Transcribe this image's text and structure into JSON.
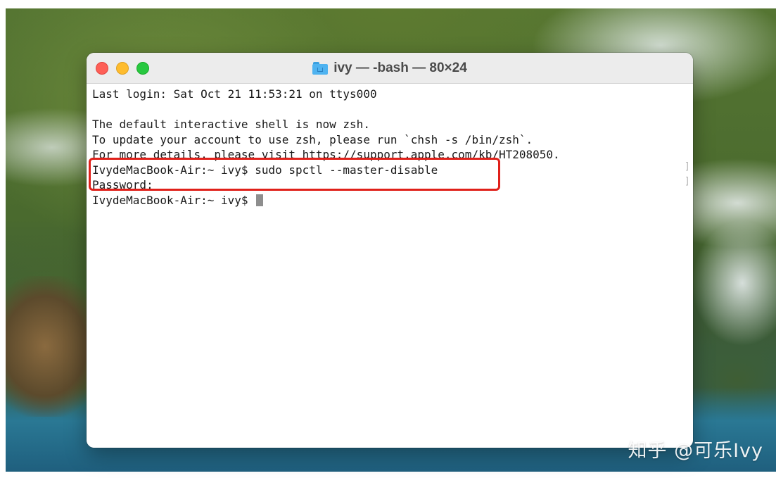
{
  "window": {
    "title": "ivy — -bash — 80×24",
    "icon": "home-folder-icon"
  },
  "terminal": {
    "lines": [
      "Last login: Sat Oct 21 11:53:21 on ttys000",
      "",
      "The default interactive shell is now zsh.",
      "To update your account to use zsh, please run `chsh -s /bin/zsh`.",
      "For more details, please visit https://support.apple.com/kb/HT208050.",
      "IvydeMacBook-Air:~ ivy$ sudo spctl --master-disable",
      "Password:",
      "IvydeMacBook-Air:~ ivy$ "
    ],
    "highlight_color": "#e0201a"
  },
  "watermark": {
    "text": "知乎 @可乐Ivy"
  }
}
